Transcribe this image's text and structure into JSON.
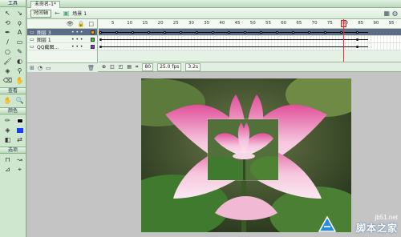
{
  "tools_panel": {
    "header": "工具",
    "view_label": "查看",
    "color_label": "颜色",
    "options_label": "选项",
    "tools": [
      {
        "icon": "arrow-icon",
        "glyph": "↖"
      },
      {
        "icon": "subselect-icon",
        "glyph": "↘"
      },
      {
        "icon": "free-transform-icon",
        "glyph": "⟲"
      },
      {
        "icon": "lasso-icon",
        "glyph": "ϙ"
      },
      {
        "icon": "pen-icon",
        "glyph": "✒"
      },
      {
        "icon": "text-icon",
        "glyph": "A"
      },
      {
        "icon": "line-icon",
        "glyph": "/"
      },
      {
        "icon": "rect-icon",
        "glyph": "▭"
      },
      {
        "icon": "oval-icon",
        "glyph": "○"
      },
      {
        "icon": "pencil-icon",
        "glyph": "✎"
      },
      {
        "icon": "brush-icon",
        "glyph": "🖌"
      },
      {
        "icon": "ink-icon",
        "glyph": "◐"
      },
      {
        "icon": "bucket-icon",
        "glyph": "◈"
      },
      {
        "icon": "dropper-icon",
        "glyph": "⚲"
      },
      {
        "icon": "eraser-icon",
        "glyph": "⌫"
      },
      {
        "icon": "hand-icon",
        "glyph": "✋"
      }
    ]
  },
  "tabbar": {
    "doc_title": "未命名-1*"
  },
  "editbar": {
    "timeline_button": "时间轴",
    "scene_label": "场景 1"
  },
  "timeline": {
    "layers": [
      {
        "name": "图层 3",
        "selected": true,
        "swatch": "#ff9a00"
      },
      {
        "name": "图层 1",
        "selected": false,
        "swatch": "#2ecc40"
      },
      {
        "name": "QQ截图...",
        "selected": false,
        "swatch": "#8a2be2"
      }
    ],
    "ruler": [
      "5",
      "10",
      "15",
      "20",
      "25",
      "30",
      "35",
      "40",
      "45",
      "50",
      "55",
      "60",
      "65",
      "70",
      "75",
      "80",
      "85",
      "90",
      "95"
    ],
    "status": {
      "current_frame": "80",
      "fps": "25.0 fps",
      "time": "3.2s"
    }
  },
  "watermark": {
    "url": "jb51.net",
    "site": "脚本之家"
  },
  "colors": {
    "panel": "#cfe6cf",
    "accent": "#5c6b86",
    "playhead": "#dd3333"
  }
}
